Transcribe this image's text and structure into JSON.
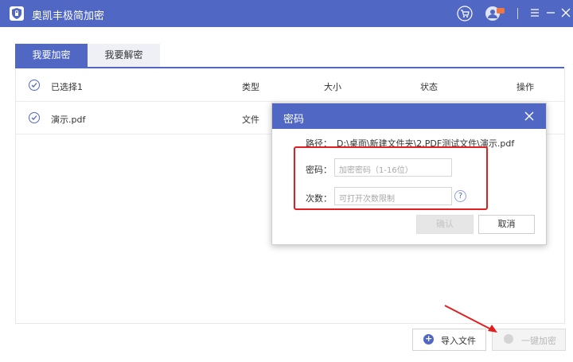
{
  "app": {
    "title": "奥凯丰极简加密"
  },
  "tabs": [
    {
      "label": "我要加密",
      "active": true
    },
    {
      "label": "我要解密",
      "active": false
    }
  ],
  "table": {
    "columns": [
      "已选择1",
      "类型",
      "大小",
      "状态",
      "操作"
    ],
    "rows": [
      {
        "name": "演示.pdf",
        "type": "文件"
      }
    ]
  },
  "buttons": {
    "import": "导入文件",
    "one_key": "一键加密"
  },
  "dialog": {
    "title": "密码",
    "path_label": "路径：",
    "path_value": "D:\\桌面\\新建文件夹\\2.PDF测试文件\\演示.pdf",
    "password_label": "密码：",
    "password_placeholder": "加密密码（1-16位）",
    "count_label": "次数：",
    "count_placeholder": "可打开次数限制",
    "help": "?",
    "ok": "确认",
    "cancel": "取消"
  },
  "colors": {
    "accent": "#5068c4",
    "highlight": "#e02020"
  }
}
